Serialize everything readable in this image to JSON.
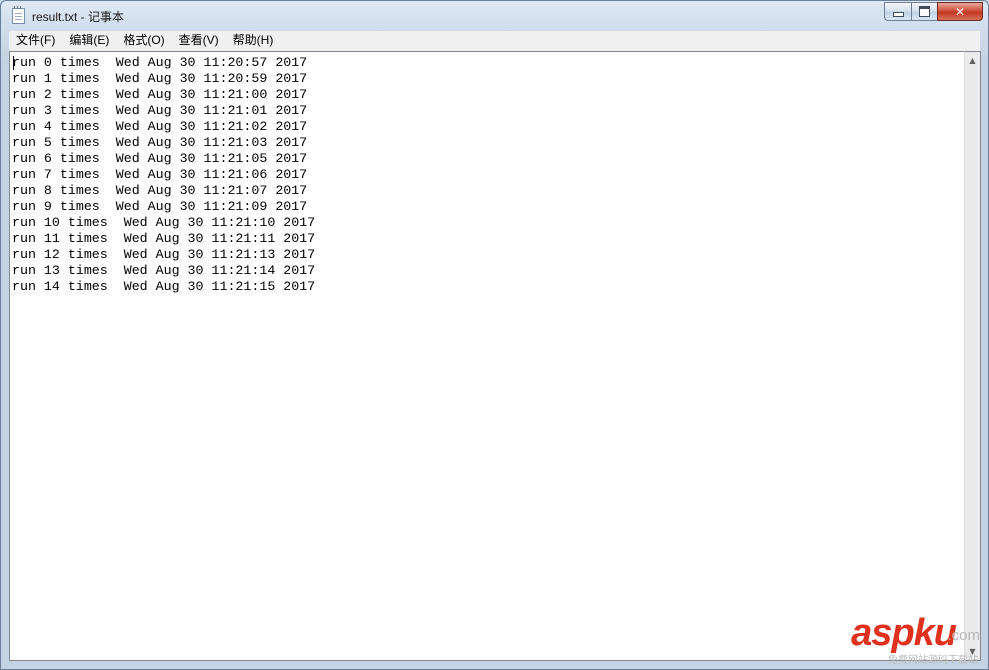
{
  "window": {
    "title": "result.txt - 记事本",
    "icon": "notepad-icon",
    "caption": {
      "minimize": "minimize-icon",
      "maximize": "maximize-icon",
      "close_glyph": "✕"
    }
  },
  "menu": [
    {
      "label": "文件(F)"
    },
    {
      "label": "编辑(E)"
    },
    {
      "label": "格式(O)"
    },
    {
      "label": "查看(V)"
    },
    {
      "label": "帮助(H)"
    }
  ],
  "document": {
    "lines": [
      "run 0 times  Wed Aug 30 11:20:57 2017",
      "run 1 times  Wed Aug 30 11:20:59 2017",
      "run 2 times  Wed Aug 30 11:21:00 2017",
      "run 3 times  Wed Aug 30 11:21:01 2017",
      "run 4 times  Wed Aug 30 11:21:02 2017",
      "run 5 times  Wed Aug 30 11:21:03 2017",
      "run 6 times  Wed Aug 30 11:21:05 2017",
      "run 7 times  Wed Aug 30 11:21:06 2017",
      "run 8 times  Wed Aug 30 11:21:07 2017",
      "run 9 times  Wed Aug 30 11:21:09 2017",
      "run 10 times  Wed Aug 30 11:21:10 2017",
      "run 11 times  Wed Aug 30 11:21:11 2017",
      "run 12 times  Wed Aug 30 11:21:13 2017",
      "run 13 times  Wed Aug 30 11:21:14 2017",
      "run 14 times  Wed Aug 30 11:21:15 2017"
    ]
  },
  "watermark": {
    "brand": "aspku",
    "domain": ".com",
    "tagline": "免费网站源码下载站"
  },
  "colors": {
    "watermark_red": "#e0301e",
    "close_red": "#c23a22"
  }
}
